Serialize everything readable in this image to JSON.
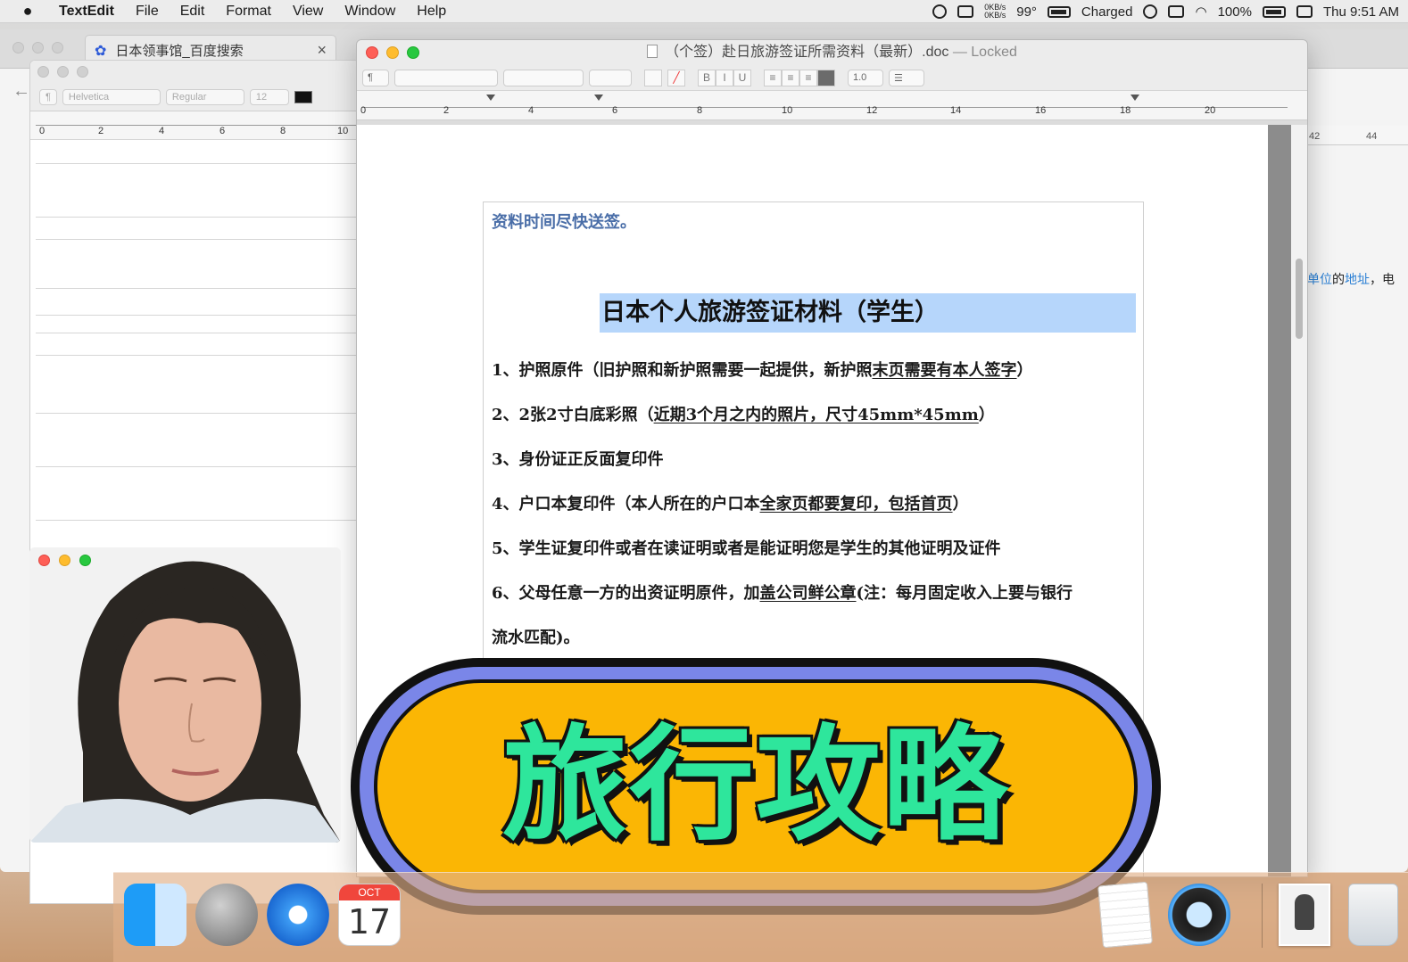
{
  "menubar": {
    "app_name": "TextEdit",
    "items": [
      "File",
      "Edit",
      "Format",
      "View",
      "Window",
      "Help"
    ],
    "status": {
      "net_up": "0KB/s",
      "net_down": "0KB/s",
      "temperature": "99°",
      "battery_state": "Charged",
      "battery_percent": "100%",
      "clock": "Thu 9:51 AM"
    }
  },
  "safari": {
    "tab_title": "日本领事馆_百度搜索",
    "tab_close": "×",
    "right_ruler_labels": [
      "42",
      "44"
    ],
    "right_text_link1": "单位",
    "right_text_mid": "的",
    "right_text_link2": "地址",
    "right_text_end": "，电"
  },
  "left_textedit": {
    "paragraph_style": "¶",
    "font_family": "Helvetica",
    "font_style": "Regular",
    "font_size": "12",
    "ruler_labels": [
      "0",
      "2",
      "4",
      "6",
      "8",
      "10"
    ]
  },
  "main_textedit": {
    "title": "（个签）赴日旅游签证所需资料（最新）.doc",
    "title_status": "— Locked",
    "toolbar": {
      "paragraph_style": "¶",
      "bold": "B",
      "italic": "I",
      "underline": "U",
      "line_spacing": "1.0",
      "list": "☰"
    },
    "ruler_labels": [
      "0",
      "2",
      "4",
      "6",
      "8",
      "10",
      "12",
      "14",
      "16",
      "18",
      "20"
    ],
    "document": {
      "top_note": "资料时间尽快送签。",
      "heading": "日本个人旅游签证材料（学生）",
      "items": [
        {
          "pre": "1、护照原件（旧护照和新护照需要一起提供，新护照",
          "u": "末页需要有本人签字",
          "post": "）"
        },
        {
          "pre": "2、2张2寸白底彩照（",
          "u": "近期3个月之内的照片，尺寸45mm*45mm",
          "post": "）"
        },
        {
          "pre": "3、身份证正反面复印件",
          "u": "",
          "post": ""
        },
        {
          "pre": "4、户口本复印件（本人所在的户口本",
          "u": "全家页都要复印，包括首页",
          "post": "）"
        },
        {
          "pre": "5、学生证复印件或者在读证明或者是能证明您是学生的其他证明及证件",
          "u": "",
          "post": ""
        },
        {
          "pre": "6、父母任意一方的出资证明原件，加",
          "u": "盖公司鲜公章",
          "post": "(注：每月固定收入上要与银行"
        },
        {
          "pre": "流水匹配)。",
          "u": "",
          "post": ""
        }
      ]
    }
  },
  "banner": {
    "text": "旅行攻略",
    "colors": {
      "fill": "#fbb604",
      "ring": "#7a86e8",
      "text": "#2ee69c"
    }
  },
  "dock": {
    "calendar_month": "OCT",
    "calendar_day": "17",
    "icons": [
      "finder-icon",
      "launchpad-icon",
      "safari-icon",
      "calendar-icon",
      "textedit-icon",
      "quicktime-icon",
      "photo-icon",
      "trash-icon"
    ]
  }
}
